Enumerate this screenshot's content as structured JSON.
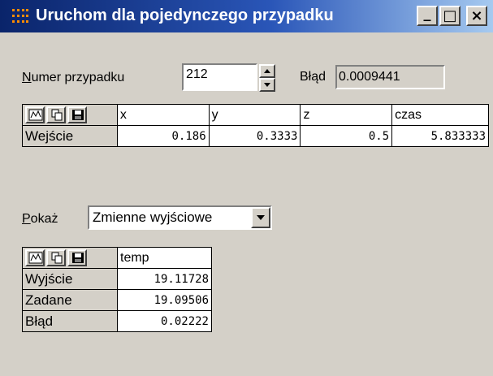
{
  "window": {
    "title": "Uruchom dla pojedynczego przypadku",
    "minimize_label": "_",
    "maximize_label": "□",
    "close_label": "×"
  },
  "case_row": {
    "case_label_first": "N",
    "case_label_rest": "umer przypadku",
    "case_value": "212",
    "error_label": "Błąd",
    "error_value": "0.0009441"
  },
  "input_table": {
    "columns": [
      "x",
      "y",
      "z",
      "czas"
    ],
    "rows": [
      {
        "label": "Wejście",
        "values": [
          "0.186",
          "0.3333",
          "0.5",
          "5.833333"
        ]
      }
    ]
  },
  "show": {
    "label_first": "P",
    "label_rest": "okaż",
    "selected": "Zmienne wyjściowe"
  },
  "output_table": {
    "columns": [
      "temp"
    ],
    "rows": [
      {
        "label": "Wyjście",
        "values": [
          "19.11728"
        ]
      },
      {
        "label": "Zadane",
        "values": [
          "19.09506"
        ]
      },
      {
        "label": "Błąd",
        "values": [
          "0.02222"
        ]
      }
    ]
  },
  "icons": {
    "app": "grid-dots-icon",
    "chart": "chart-icon",
    "copy": "copy-icon",
    "save": "save-disk-icon"
  },
  "colors": {
    "titlebar_start": "#0a246a",
    "titlebar_end": "#a6caf0",
    "face": "#d4d0c8"
  }
}
